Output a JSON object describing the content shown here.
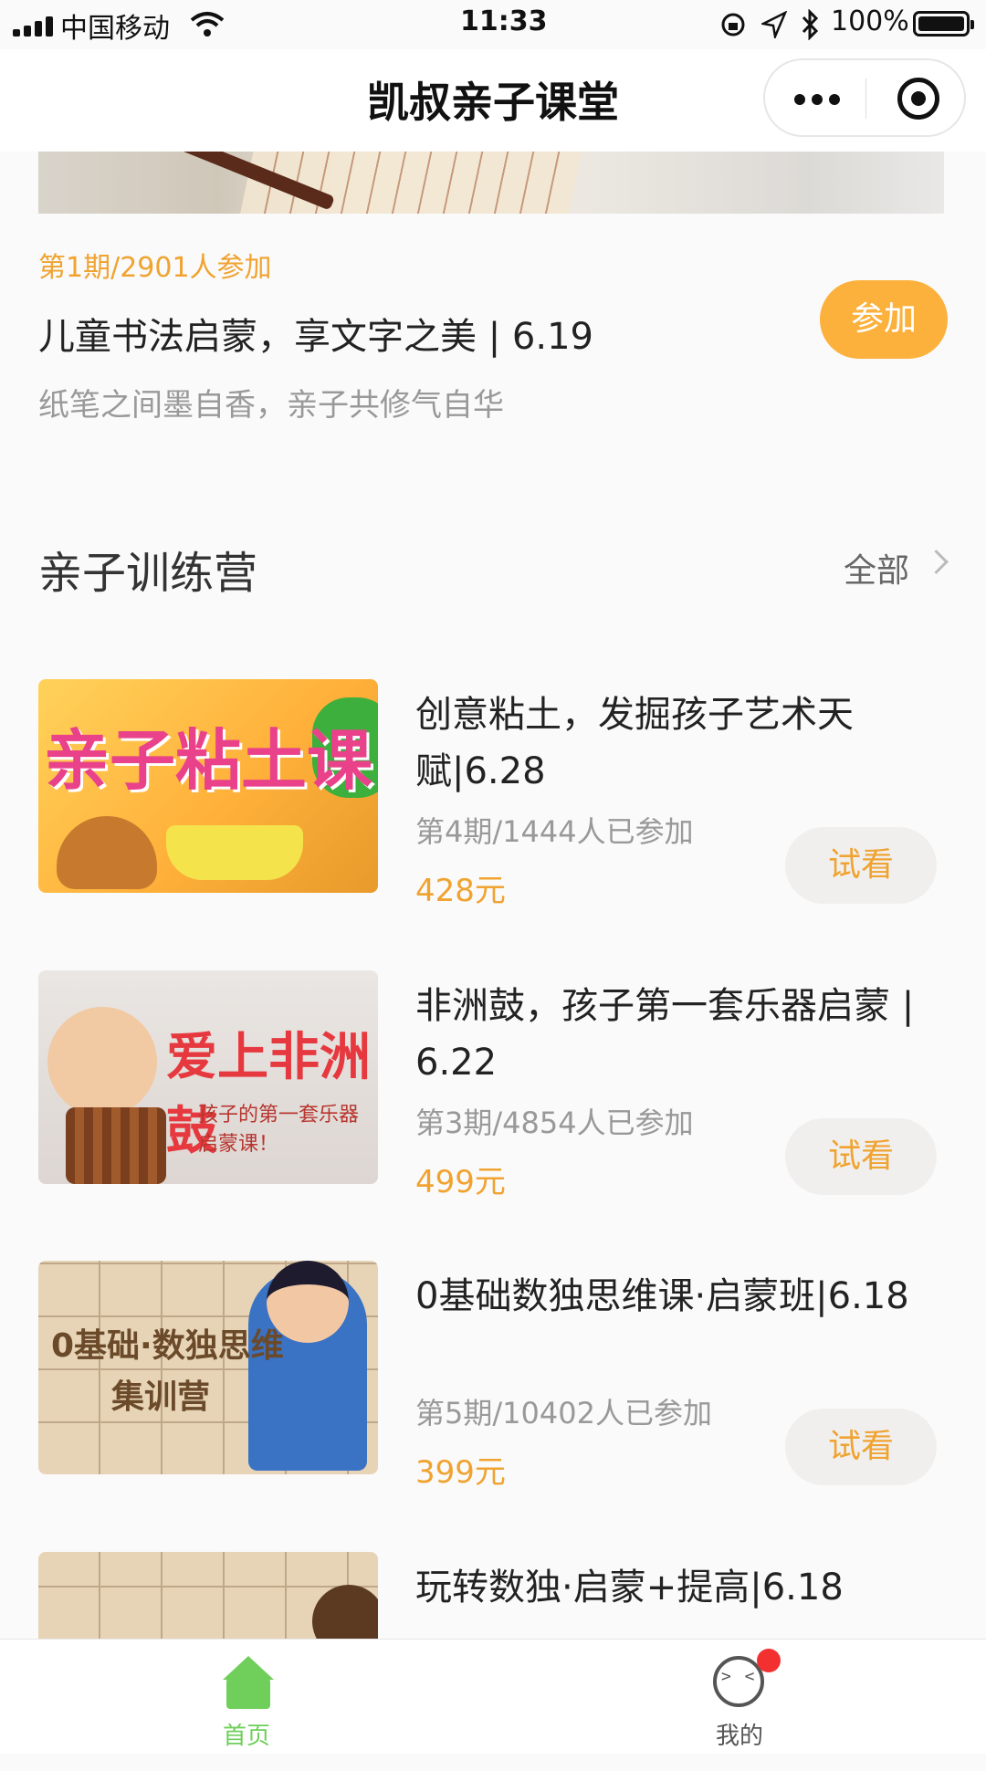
{
  "status_bar": {
    "carrier": "中国移动",
    "time": "11:33",
    "battery": "100%"
  },
  "navbar": {
    "title": "凯叔亲子课堂"
  },
  "featured": {
    "issue": "第1期/2901人参加",
    "title": "儿童书法启蒙，享文字之美 | 6.19",
    "subtitle": "纸笔之间墨自香，亲子共修气自华",
    "join_label": "参加"
  },
  "section": {
    "title": "亲子训练营",
    "all_label": "全部"
  },
  "thumb_text": {
    "clay": "亲子粘土课",
    "drum": "爱上非洲鼓",
    "drum_sub": "孩子的第一套乐器启蒙课！",
    "sudoku_1": "0基础·数独思维",
    "sudoku_2": "集训营"
  },
  "courses": [
    {
      "title": "创意粘土，发掘孩子艺术天赋|6.28",
      "meta": "第4期/1444人已参加",
      "price": "428元",
      "action": "试看"
    },
    {
      "title": "非洲鼓，孩子第一套乐器启蒙 | 6.22",
      "meta": "第3期/4854人已参加",
      "price": "499元",
      "action": "试看"
    },
    {
      "title": "0基础数独思维课·启蒙班|6.18",
      "meta": "第5期/10402人已参加",
      "price": "399元",
      "action": "试看"
    },
    {
      "title": "玩转数独·启蒙+提高|6.18"
    }
  ],
  "tabbar": {
    "home_label": "首页",
    "mine_label": "我的",
    "active_color": "#6fcf5a",
    "inactive_color": "#555555"
  }
}
